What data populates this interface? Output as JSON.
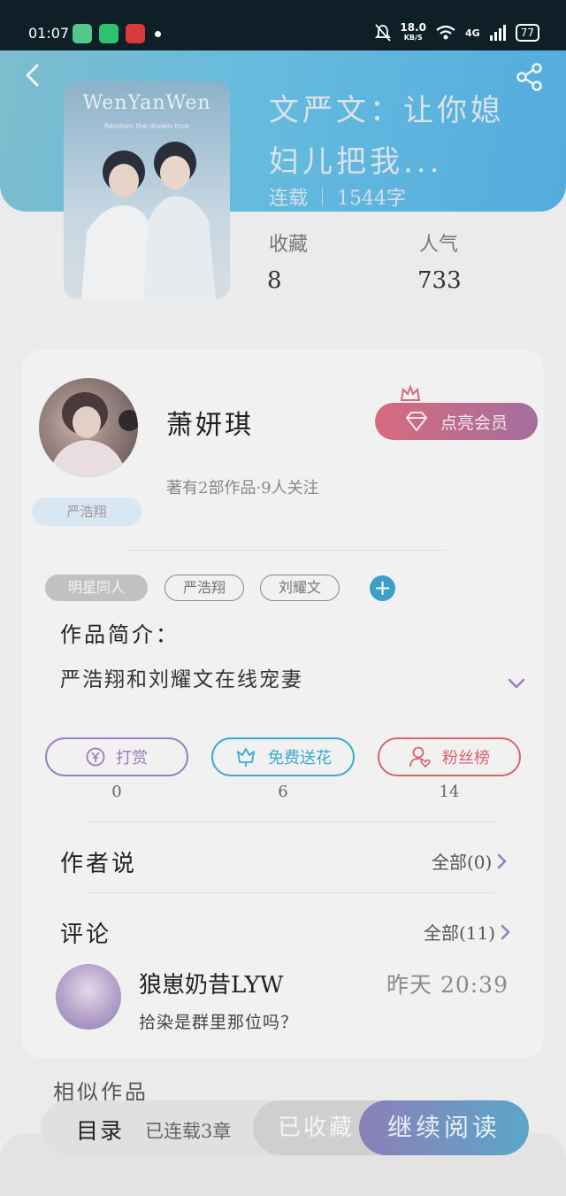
{
  "status_bar": {
    "time": "01:07",
    "net_speed": "18.0",
    "net_unit": "KB/S",
    "network": "4G",
    "battery": "77"
  },
  "book": {
    "cover_title": "WenYanWen",
    "cover_subtitle": "Random the dream true",
    "title": "文严文：让你媳妇儿把我...",
    "status": "连载",
    "word_count": "1544字",
    "stats": [
      {
        "label": "收藏",
        "value": "8"
      },
      {
        "label": "人气",
        "value": "733"
      }
    ]
  },
  "author": {
    "name": "萧妍琪",
    "tag": "严浩翔",
    "meta": "著有2部作品·9人关注",
    "vip_button": "点亮会员"
  },
  "tags": [
    "明星同人",
    "严浩翔",
    "刘耀文"
  ],
  "intro": {
    "label": "作品简介：",
    "text": "严浩翔和刘耀文在线宠妻"
  },
  "actions": [
    {
      "label": "打赏",
      "count": "0",
      "icon": "yen-icon",
      "color": "#9a7cc0"
    },
    {
      "label": "免费送花",
      "count": "6",
      "icon": "flower-icon",
      "color": "#3aa9cf"
    },
    {
      "label": "粉丝榜",
      "count": "14",
      "icon": "fan-icon",
      "color": "#d9636f"
    }
  ],
  "author_says": {
    "title": "作者说",
    "more": "全部(0)"
  },
  "comments": {
    "title": "评论",
    "more": "全部(11)",
    "items": [
      {
        "name": "狼崽奶昔LYW",
        "time": "昨天 20:39",
        "text": "拾染是群里那位吗？"
      }
    ]
  },
  "similar": {
    "title": "相似作品"
  },
  "bottom_bar": {
    "catalog": "目录",
    "serial_info": "已连载3章",
    "favorite": "已收藏",
    "continue": "继续阅读"
  },
  "colors": {
    "header_gradient": [
      "#6fb7c9",
      "#3ea3dc"
    ],
    "vip_gradient": [
      "#d86a7e",
      "#a36f9e"
    ],
    "read_gradient": [
      "#8c7fb8",
      "#5ba6c9"
    ],
    "accent_purple": "#9a7cc0"
  }
}
